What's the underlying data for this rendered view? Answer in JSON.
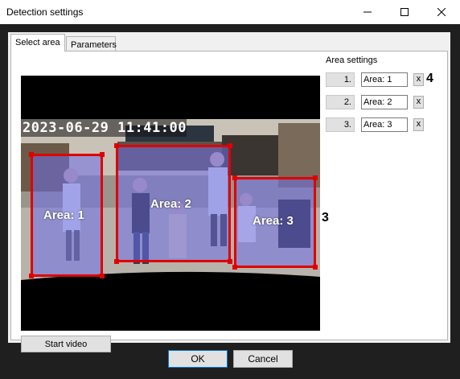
{
  "window": {
    "title": "Detection settings"
  },
  "tabs": [
    {
      "label": "Select area",
      "active": true
    },
    {
      "label": "Parameters",
      "active": false
    }
  ],
  "video": {
    "timestamp": "2023-06-29  11:41:00",
    "start_button": "Start video",
    "areas": [
      {
        "label": "Area: 1"
      },
      {
        "label": "Area: 2"
      },
      {
        "label": "Area: 3"
      }
    ]
  },
  "area_settings": {
    "title": "Area settings",
    "rows": [
      {
        "number": "1.",
        "name": "Area: 1",
        "delete": "x"
      },
      {
        "number": "2.",
        "name": "Area: 2",
        "delete": "x"
      },
      {
        "number": "3.",
        "name": "Area: 3",
        "delete": "x"
      }
    ]
  },
  "callouts": {
    "three": "3",
    "four": "4"
  },
  "buttons": {
    "ok": "OK",
    "cancel": "Cancel"
  },
  "colors": {
    "area_border": "#e00000",
    "area_fill": "#6e6ee6",
    "primary_focus": "#0078d7"
  }
}
